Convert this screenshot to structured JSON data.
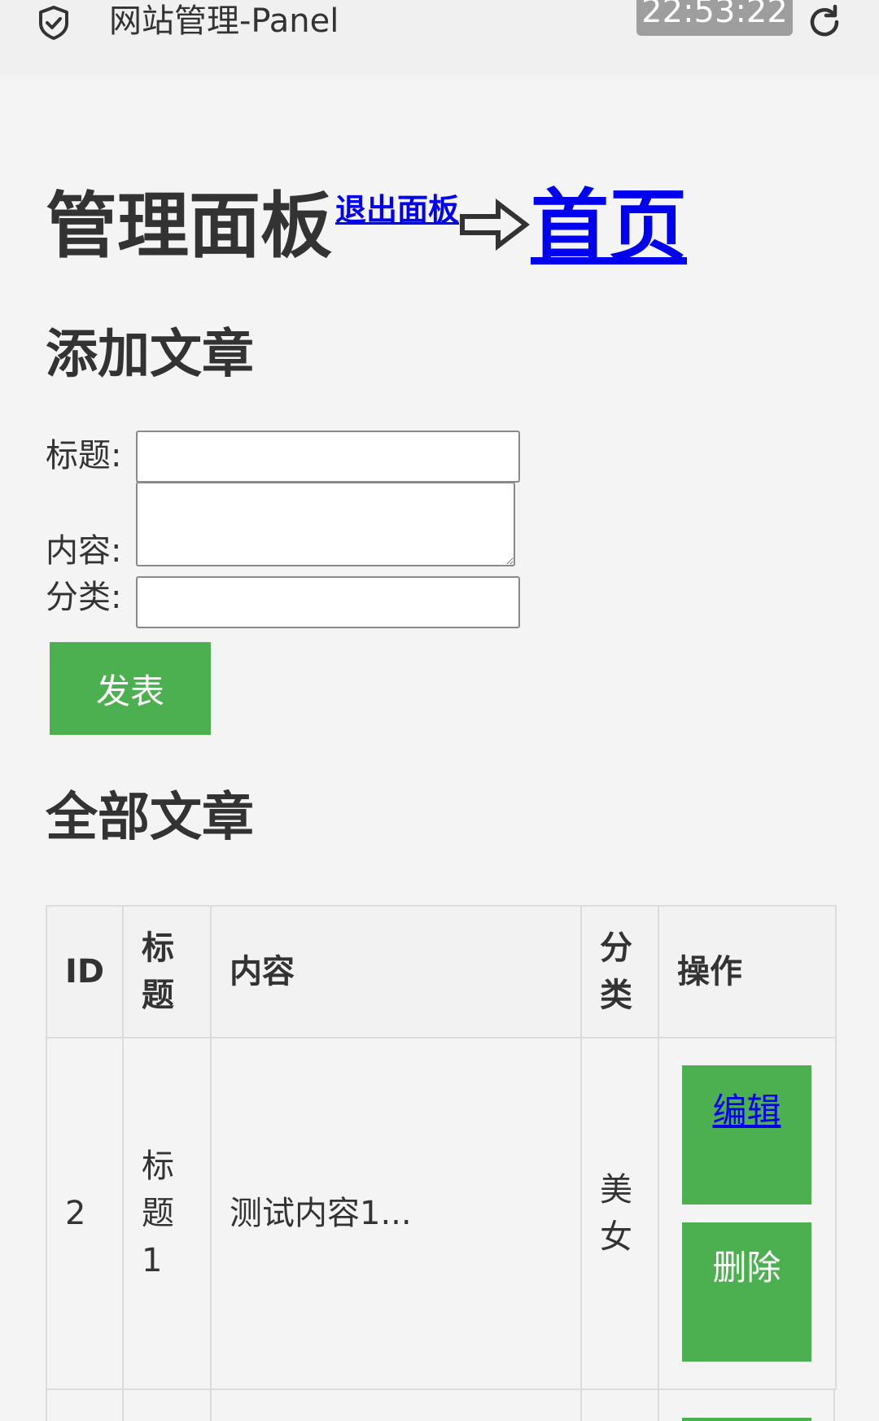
{
  "topbar": {
    "title": "网站管理-Panel",
    "clock": "22:53:22",
    "icons": {
      "left": "shield-check-icon",
      "right": "refresh-icon"
    }
  },
  "heading": {
    "title": "管理面板",
    "logout_link": "退出面板",
    "arrow_icon": "arrow-right-outline-icon",
    "home_link": "首页"
  },
  "add_section": {
    "title": "添加文章",
    "title_label": "标题:",
    "content_label": "内容:",
    "category_label": "分类:",
    "title_value": "",
    "content_value": "",
    "category_value": "",
    "submit_label": "发表"
  },
  "list_section": {
    "title": "全部文章",
    "columns": [
      "ID",
      "标题",
      "内容",
      "分类",
      "操作"
    ],
    "rows": [
      {
        "id": "2",
        "title": "标题1",
        "content": "测试内容1...",
        "category": "美女",
        "edit_label": "编辑",
        "delete_label": "删除"
      }
    ]
  },
  "colors": {
    "accent_green": "#4caf50",
    "link_blue": "#0000ee",
    "background": "#f4f4f4"
  }
}
